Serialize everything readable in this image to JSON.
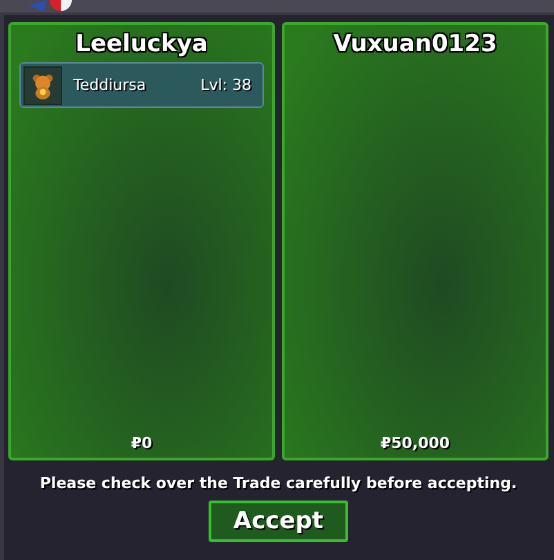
{
  "panels": [
    {
      "trainer": "Leeluckya",
      "pokemon": [
        {
          "name": "Teddiursa",
          "level": "Lvl: 38"
        }
      ],
      "money": "₽0"
    },
    {
      "trainer": "Vuxuan0123",
      "money": "₽50,000"
    }
  ],
  "notice": "Please check over the Trade carefully before accepting.",
  "accept_button": "Accept"
}
